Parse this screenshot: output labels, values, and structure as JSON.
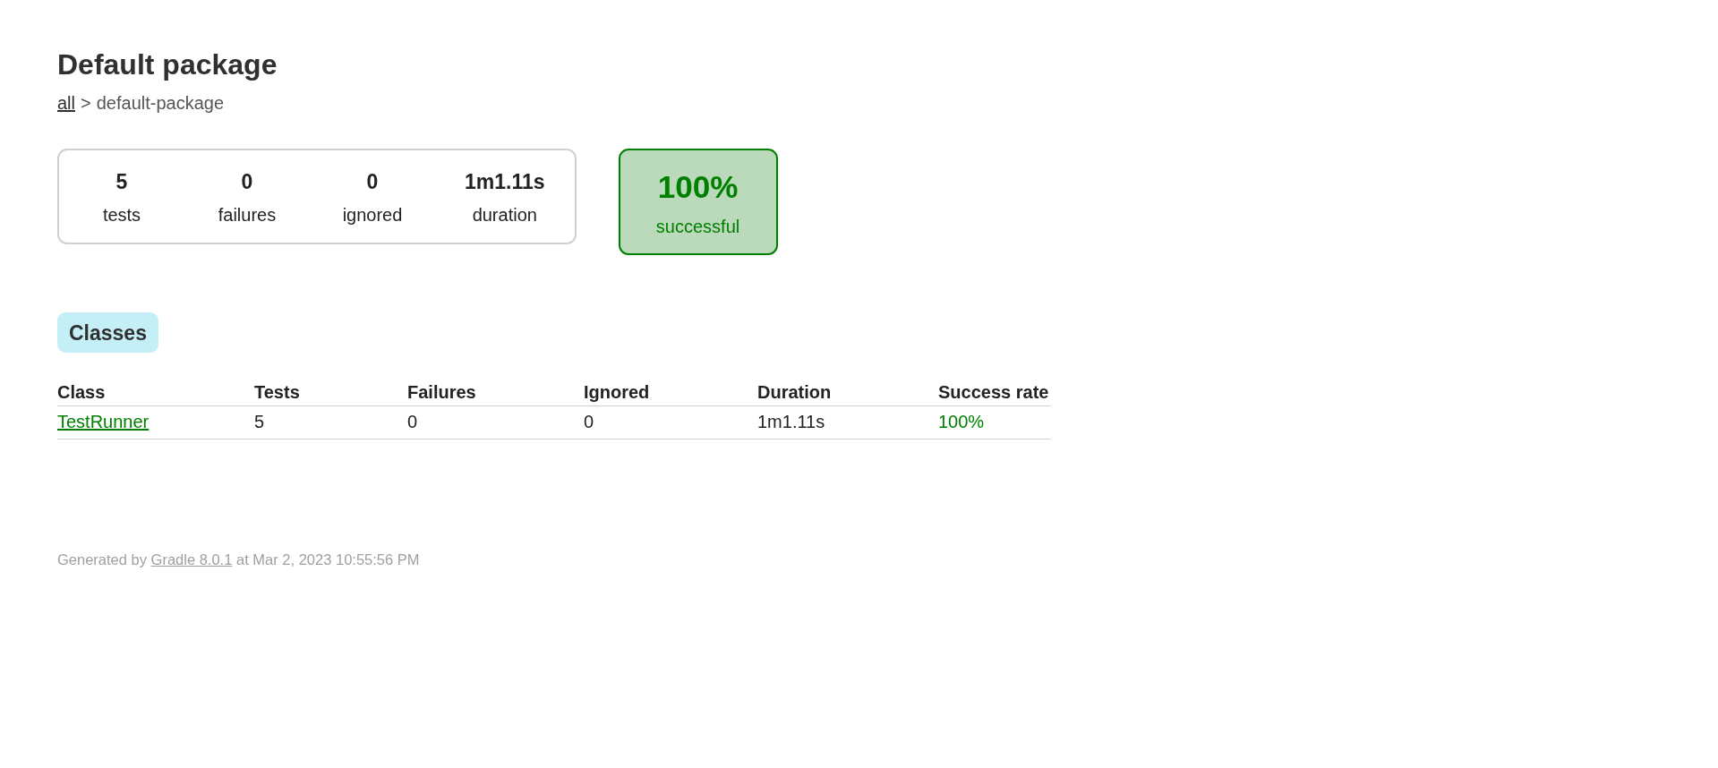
{
  "title": "Default package",
  "breadcrumb": {
    "link": "all",
    "separator": ">",
    "current": "default-package"
  },
  "summary": {
    "counters": [
      {
        "value": "5",
        "label": "tests"
      },
      {
        "value": "0",
        "label": "failures"
      },
      {
        "value": "0",
        "label": "ignored"
      },
      {
        "value": "1m1.11s",
        "label": "duration"
      }
    ],
    "success_rate": {
      "value": "100%",
      "label": "successful",
      "passed": true
    }
  },
  "tabs": [
    {
      "label": "Classes",
      "selected": true
    }
  ],
  "table": {
    "columns": [
      "Class",
      "Tests",
      "Failures",
      "Ignored",
      "Duration",
      "Success rate"
    ],
    "rows": [
      {
        "cells": [
          "TestRunner",
          "5",
          "0",
          "0",
          "1m1.11s",
          "100%"
        ],
        "passed": true
      }
    ]
  },
  "footer": {
    "text_before": "Generated by",
    "link": "Gradle 8.0.1",
    "text_after": "at Mar 2, 2023 10:55:56 PM"
  }
}
